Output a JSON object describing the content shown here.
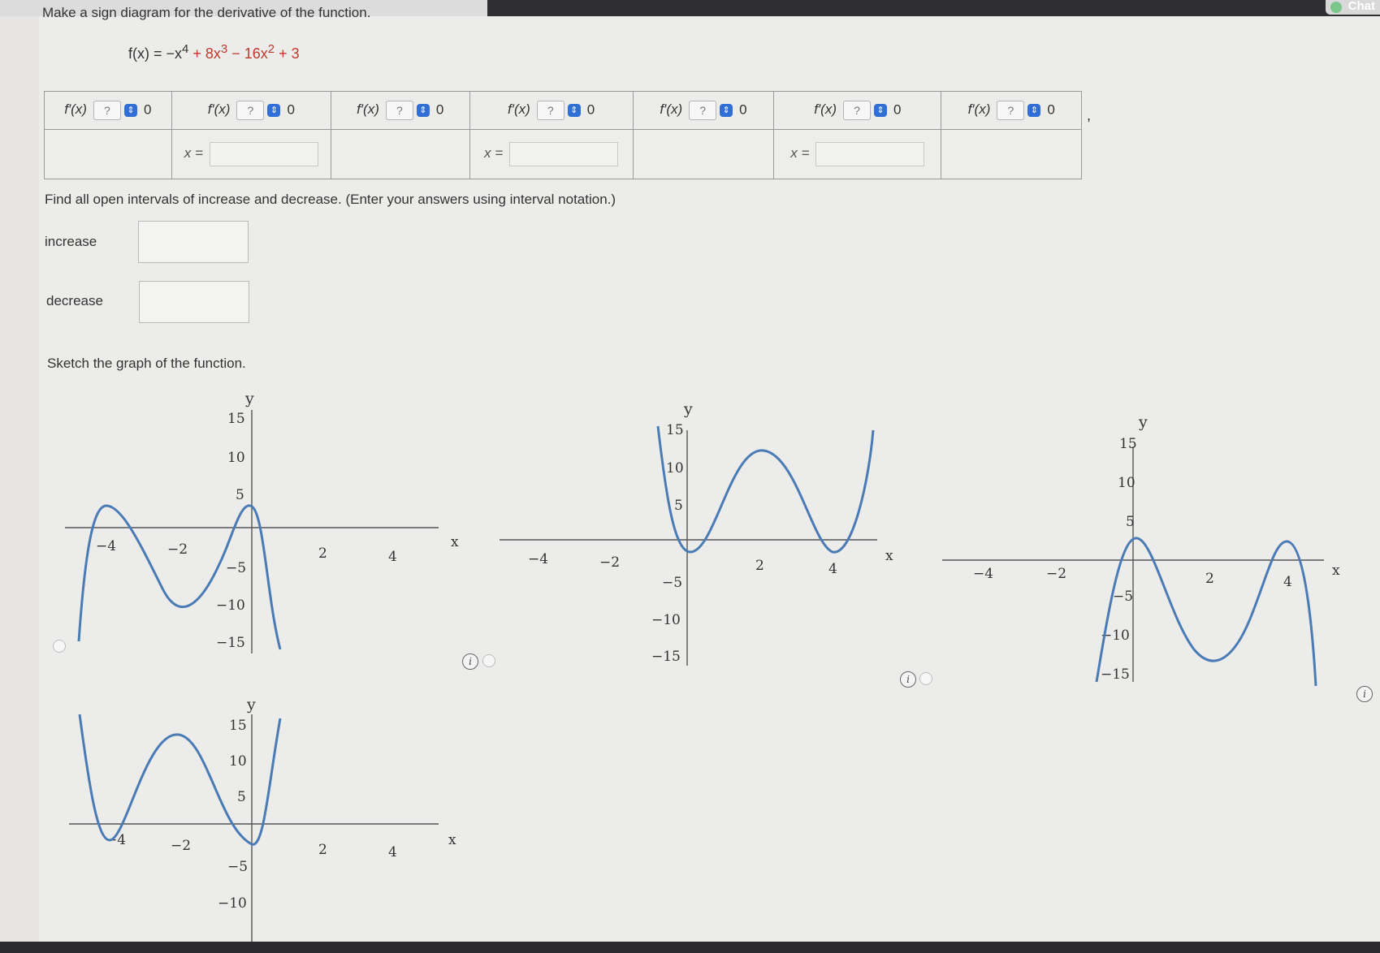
{
  "header": {
    "chat_label": "Chat"
  },
  "question": {
    "instruction": "Make a sign diagram for the derivative of the function.",
    "function_prefix": "f(x) = −x",
    "function_exp1": "4",
    "function_mid1": " + 8x",
    "function_exp2": "3",
    "function_mid2": " − 16x",
    "function_exp3": "2",
    "function_end": " + 3"
  },
  "sign_table": {
    "fprime_label": "f′(x)",
    "select_placeholder": "?",
    "select_arrow": "⇕",
    "zero": "0",
    "x_label": "x =",
    "trailing": ","
  },
  "intervals": {
    "instruction": "Find all open intervals of increase and decrease. (Enter your answers using interval notation.)",
    "increase_label": "increase",
    "decrease_label": "decrease"
  },
  "sketch": {
    "instruction": "Sketch the graph of the function."
  },
  "graph_labels": {
    "x_axis": "x",
    "y_axis": "y",
    "x_ticks": [
      "−4",
      "−2",
      "2",
      "4"
    ],
    "y_ticks": [
      "15",
      "10",
      "5",
      "−5",
      "−10",
      "−15"
    ]
  },
  "options": [
    {
      "name": "graph-option-a",
      "description": "local maxima near x=-4 and x=0, local minimum near x=-2"
    },
    {
      "name": "graph-option-b",
      "description": "local minima near x=0 and x=4, local maximum near x=2"
    },
    {
      "name": "graph-option-c",
      "description": "local maxima near x=0 and x=4, local minimum near x=2"
    },
    {
      "name": "graph-option-d",
      "description": "local minima near x=-4 and x=0, local maximum near x=-2"
    }
  ],
  "info_glyph": "i",
  "colors": {
    "curve": "#4a7bb5",
    "select_arrow": "#2f6fd6",
    "function_highlight": "#c0392b"
  }
}
